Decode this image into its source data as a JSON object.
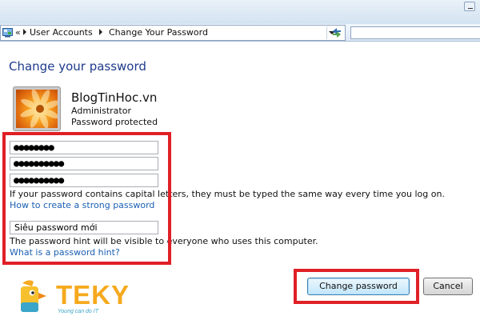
{
  "address_bar": {
    "back_glyph": "«",
    "breadcrumbs": [
      "User Accounts",
      "Change Your Password"
    ]
  },
  "page": {
    "title": "Change your password"
  },
  "account": {
    "name": "BlogTinHoc.vn",
    "role": "Administrator",
    "status": "Password protected",
    "avatar_icon": "flower-icon"
  },
  "form": {
    "current_password_value": "●●●●●●●●",
    "new_password_value": "●●●●●●●●●●",
    "confirm_password_value": "●●●●●●●●●●",
    "caps_note": "If your password contains capital letters, they must be typed the same way every time you log on.",
    "strong_password_link": "How to create a strong password",
    "hint_value": "Siêu password mới",
    "hint_note": "The password hint will be visible to everyone who uses this computer.",
    "hint_help_link": "What is a password hint?"
  },
  "buttons": {
    "change_password": "Change password",
    "cancel": "Cancel"
  },
  "watermark": {
    "brand": "TEKY",
    "tagline": "Young can do IT"
  },
  "colors": {
    "highlight_frame": "#e01f26",
    "title_text": "#1e3b8c",
    "link": "#1a5fb4",
    "brand_orange": "#f6a91e",
    "brand_blue": "#3aa5c9"
  }
}
